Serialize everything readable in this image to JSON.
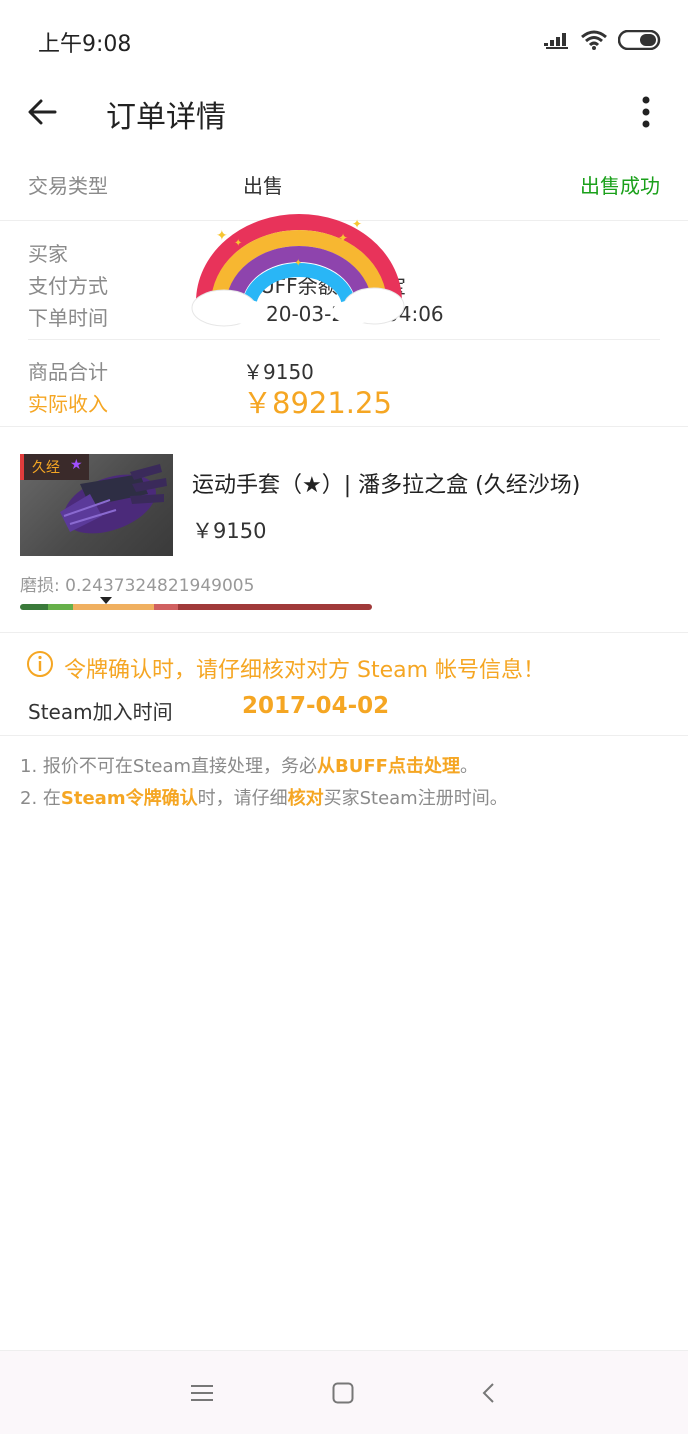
{
  "status_bar": {
    "time": "上午9:08"
  },
  "header": {
    "title": "订单详情"
  },
  "trade": {
    "type_label": "交易类型",
    "type_value": "出售",
    "status": "出售成功"
  },
  "order": {
    "buyer_label": "买家",
    "payment_label": "支付方式",
    "payment_value_visible_a": "UFF余额",
    "payment_value_visible_b": "宝",
    "time_label": "下单时间",
    "time_value_visible_a": "20-03-2",
    "time_value_visible_b": "04:06",
    "total_label": "商品合计",
    "total_value": "￥9150",
    "income_label": "实际收入",
    "income_value": "￥8921.25"
  },
  "item": {
    "tag_wear": "久经",
    "tag_star": "★",
    "name": "运动手套（★）| 潘多拉之盒 (久经沙场)",
    "price": "￥9150",
    "wear_text": "磨损: 0.2437324821949005",
    "wear_value": 0.2437324821949005
  },
  "warning": {
    "text": "令牌确认时，请仔细核对对方 Steam 帐号信息！",
    "steam_join_label": "Steam加入时间",
    "steam_join_date": "2017-04-02"
  },
  "notes": {
    "n1_a": "1. 报价不可在Steam直接处理，务必",
    "n1_b": "从BUFF点击处理",
    "n1_c": "。",
    "n2_a": "2. 在",
    "n2_b": "Steam令牌确认",
    "n2_c": "时，请仔细",
    "n2_d": "核对",
    "n2_e": "买家Steam注册时间。"
  },
  "colors": {
    "success": "#1aa01a",
    "accent": "#f5a623",
    "wear_fn": "#3a7a3a",
    "wear_mw": "#66b04a",
    "wear_ft": "#f0b060",
    "wear_ww": "#d06060",
    "wear_bs": "#a03a3a"
  },
  "icons": {
    "back": "arrow-left-icon",
    "menu": "more-vertical-icon",
    "warning": "info-circle-icon",
    "nav_menu": "menu-lines-icon",
    "nav_home": "square-home-icon",
    "nav_back": "chevron-left-icon"
  }
}
